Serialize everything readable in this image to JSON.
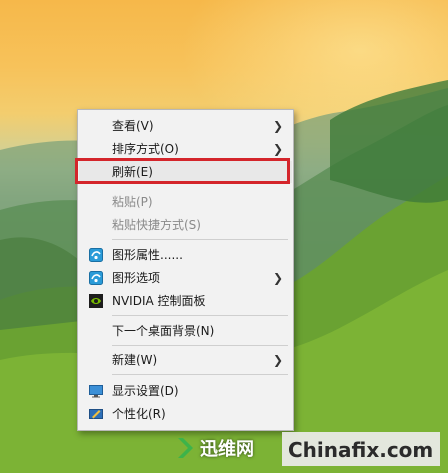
{
  "context_menu": {
    "items": [
      {
        "label": "查看(V)",
        "submenu": true
      },
      {
        "label": "排序方式(O)",
        "submenu": true
      },
      {
        "label": "刷新(E)",
        "highlighted": true
      },
      {
        "label": "粘贴(P)",
        "disabled": true
      },
      {
        "label": "粘贴快捷方式(S)",
        "disabled": true
      },
      {
        "label": "图形属性......",
        "icon": "intel-graphics-icon"
      },
      {
        "label": "图形选项",
        "icon": "intel-graphics-icon",
        "submenu": true
      },
      {
        "label": "NVIDIA 控制面板",
        "icon": "nvidia-icon"
      },
      {
        "label": "下一个桌面背景(N)"
      },
      {
        "label": "新建(W)",
        "submenu": true
      },
      {
        "label": "显示设置(D)",
        "icon": "display-icon"
      },
      {
        "label": "个性化(R)",
        "icon": "personalize-icon"
      }
    ]
  },
  "watermark": {
    "cn_text": "迅维网",
    "en_text": "Chinafix.com"
  },
  "colors": {
    "highlight_border": "#d4252b",
    "menu_bg": "#f2f2f2"
  }
}
